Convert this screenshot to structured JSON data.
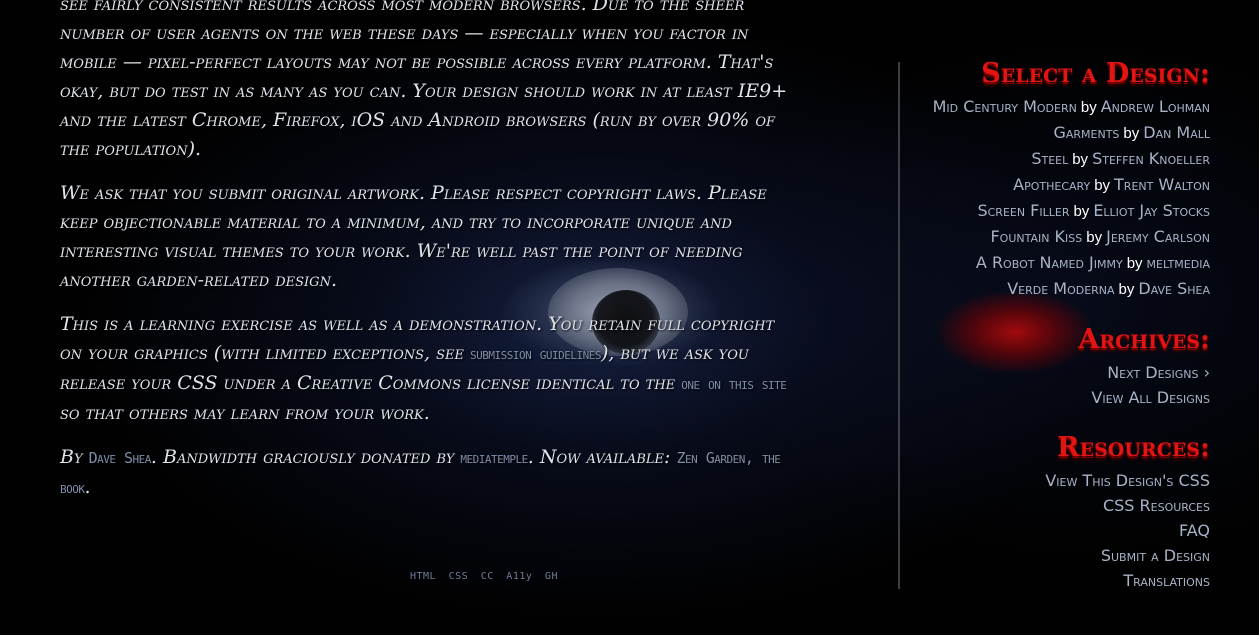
{
  "main": {
    "p1": "see fairly consistent results across most modern browsers. Due to the sheer number of user agents on the web these days — especially when you factor in mobile — pixel-perfect layouts may not be possible across every platform. That's okay, but do test in as many as you can. Your design should work in at least IE9+ and the latest Chrome, Firefox, iOS and Android browsers (run by over 90% of the population).",
    "p2": "We ask that you submit original artwork. Please respect copyright laws. Please keep objectionable material to a minimum, and try to incorporate unique and interesting visual themes to your work. We're well past the point of needing another garden-related design.",
    "p3_a": "This is a learning exercise as well as a demonstration. You retain full copyright on your graphics (with limited exceptions, see ",
    "p3_link1": "submission guidelines",
    "p3_b": "), but we ask you release your CSS under a Creative Commons license identical to the ",
    "p3_link2": "one on this site",
    "p3_c": " so that others may learn from your work.",
    "p4_a": "By ",
    "p4_link1": "Dave Shea",
    "p4_b": ". Bandwidth graciously donated by ",
    "p4_link2": "mediatemple",
    "p4_c": ". Now available: ",
    "p4_link3": "Zen Garden, the book",
    "p4_d": "."
  },
  "footer": {
    "html": "HTML",
    "css": "CSS",
    "cc": "CC",
    "a11y": "A11y",
    "gh": "GH"
  },
  "sidebar": {
    "select_heading": "Select a Design:",
    "designs": [
      {
        "title": "Mid Century Modern",
        "by": "by",
        "author": "Andrew Lohman"
      },
      {
        "title": "Garments",
        "by": "by",
        "author": "Dan Mall"
      },
      {
        "title": "Steel",
        "by": "by",
        "author": "Steffen Knoeller"
      },
      {
        "title": "Apothecary",
        "by": "by",
        "author": "Trent Walton"
      },
      {
        "title": "Screen Filler",
        "by": "by",
        "author": "Elliot Jay Stocks"
      },
      {
        "title": "Fountain Kiss",
        "by": "by",
        "author": "Jeremy Carlson"
      },
      {
        "title": "A Robot Named Jimmy",
        "by": "by",
        "author": "meltmedia"
      },
      {
        "title": "Verde Moderna",
        "by": "by",
        "author": "Dave Shea"
      }
    ],
    "archives_heading": "Archives:",
    "next_designs": "Next Designs ›",
    "view_all": "View All Designs",
    "resources_heading": "Resources:",
    "resources": [
      "View This Design's CSS",
      "CSS Resources",
      "FAQ",
      "Submit a Design",
      "Translations"
    ]
  },
  "colors": {
    "heading": "#e21414",
    "link": "#7d8ea8",
    "text": "#dfe3ea",
    "background": "#010101"
  }
}
